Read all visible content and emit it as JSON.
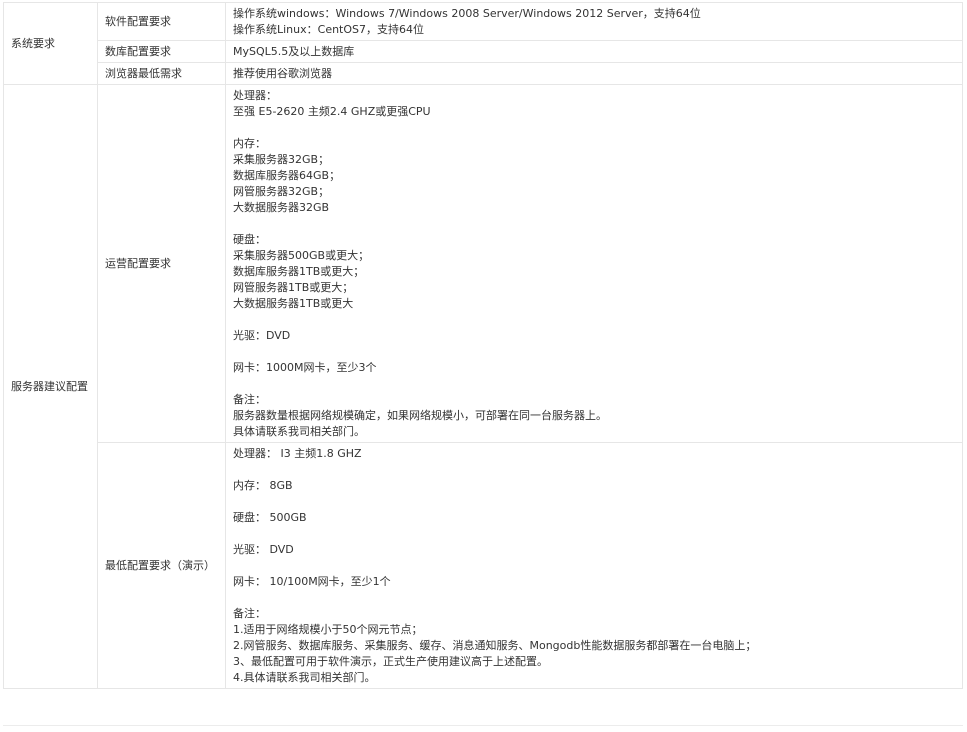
{
  "table": {
    "rows": [
      {
        "group": "系统要求",
        "items": [
          {
            "label": "软件配置要求",
            "lines": [
              "操作系统windows：Windows 7/Windows 2008 Server/Windows 2012 Server，支持64位",
              "操作系统Linux：CentOS7，支持64位"
            ]
          },
          {
            "label": "数库配置要求",
            "lines": [
              "MySQL5.5及以上数据库"
            ]
          },
          {
            "label": "浏览器最低需求",
            "lines": [
              "推荐使用谷歌浏览器"
            ]
          }
        ]
      },
      {
        "group": "服务器建议配置",
        "items": [
          {
            "label": "运营配置要求",
            "lines": [
              "处理器：",
              "至强 E5-2620 主频2.4 GHZ或更强CPU",
              "",
              "内存：",
              "采集服务器32GB；",
              "数据库服务器64GB；",
              "网管服务器32GB；",
              "大数据服务器32GB",
              "",
              "硬盘：",
              "采集服务器500GB或更大；",
              "数据库服务器1TB或更大；",
              "网管服务器1TB或更大；",
              "大数据服务器1TB或更大",
              "",
              "光驱：DVD",
              "",
              "网卡：1000M网卡，至少3个",
              "",
              "备注：",
              "服务器数量根据网络规模确定，如果网络规模小，可部署在同一台服务器上。",
              "具体请联系我司相关部门。"
            ]
          },
          {
            "label": "最低配置要求（演示）",
            "lines": [
              "处理器： I3 主频1.8 GHZ",
              "",
              "内存： 8GB",
              "",
              "硬盘： 500GB",
              "",
              "光驱： DVD",
              "",
              "网卡： 10/100M网卡，至少1个",
              "",
              "备注：",
              "1.适用于网络规模小于50个网元节点；",
              "2.网管服务、数据库服务、采集服务、缓存、消息通知服务、Mongodb性能数据服务都部署在一台电脑上；",
              "3、最低配置可用于软件演示，正式生产使用建议高于上述配置。",
              "4.具体请联系我司相关部门。"
            ]
          }
        ]
      }
    ]
  }
}
